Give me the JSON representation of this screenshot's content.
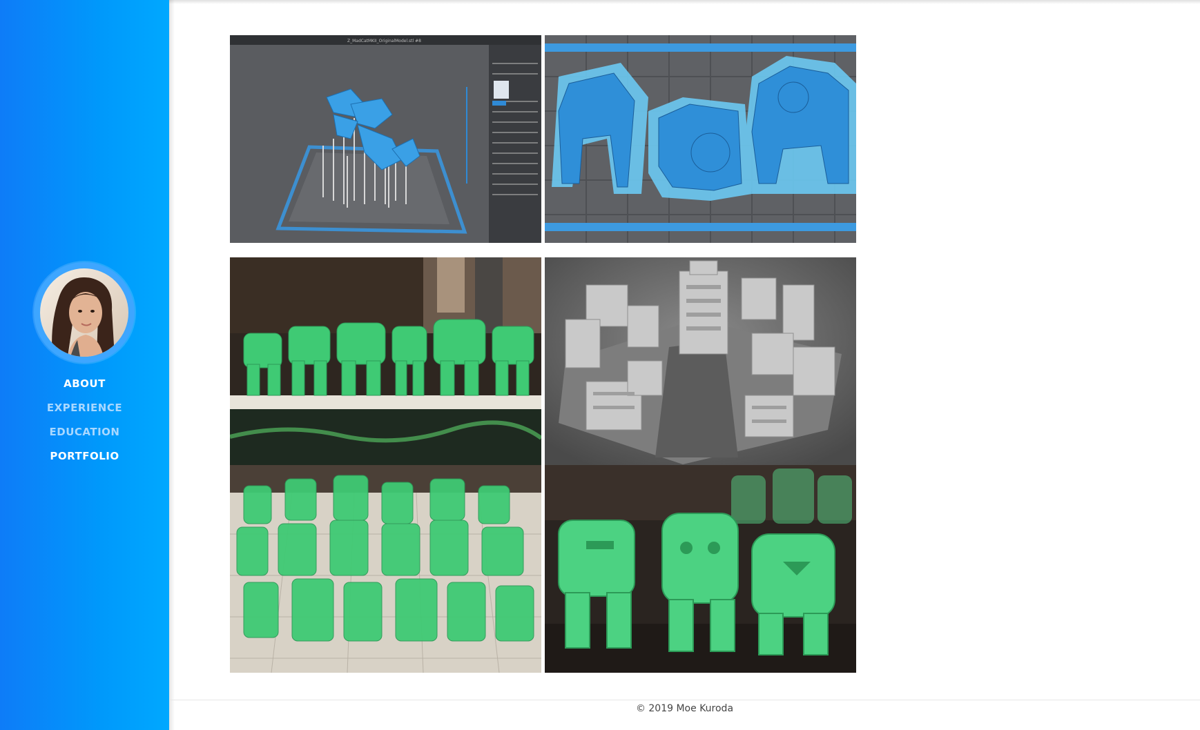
{
  "nav": {
    "items": [
      {
        "label": "ABOUT",
        "state": "active"
      },
      {
        "label": "EXPERIENCE",
        "state": "dim"
      },
      {
        "label": "EDUCATION",
        "state": "dim"
      },
      {
        "label": "PORTFOLIO",
        "state": "active"
      }
    ]
  },
  "gallery": {
    "items": [
      {
        "name": "slicer-support-view"
      },
      {
        "name": "slicer-build-plate"
      },
      {
        "name": "green-resin-mechs-lineup"
      },
      {
        "name": "grey-city-terrain-render"
      },
      {
        "name": "green-resin-mech-army"
      },
      {
        "name": "green-resin-mechs-closeup"
      }
    ]
  },
  "slicer": {
    "window_title": "Z_MadCatMKII_OriginalModel.stl #8"
  },
  "footer": {
    "copyright": "© 2019 Moe Kuroda"
  },
  "colors": {
    "sidebar_start": "#0e7cf8",
    "sidebar_end": "#00a8ff",
    "nav_active": "#ffffff",
    "nav_dim": "#a9d8ff",
    "resin_green": "#3fca74",
    "model_blue": "#3aa0e6"
  }
}
